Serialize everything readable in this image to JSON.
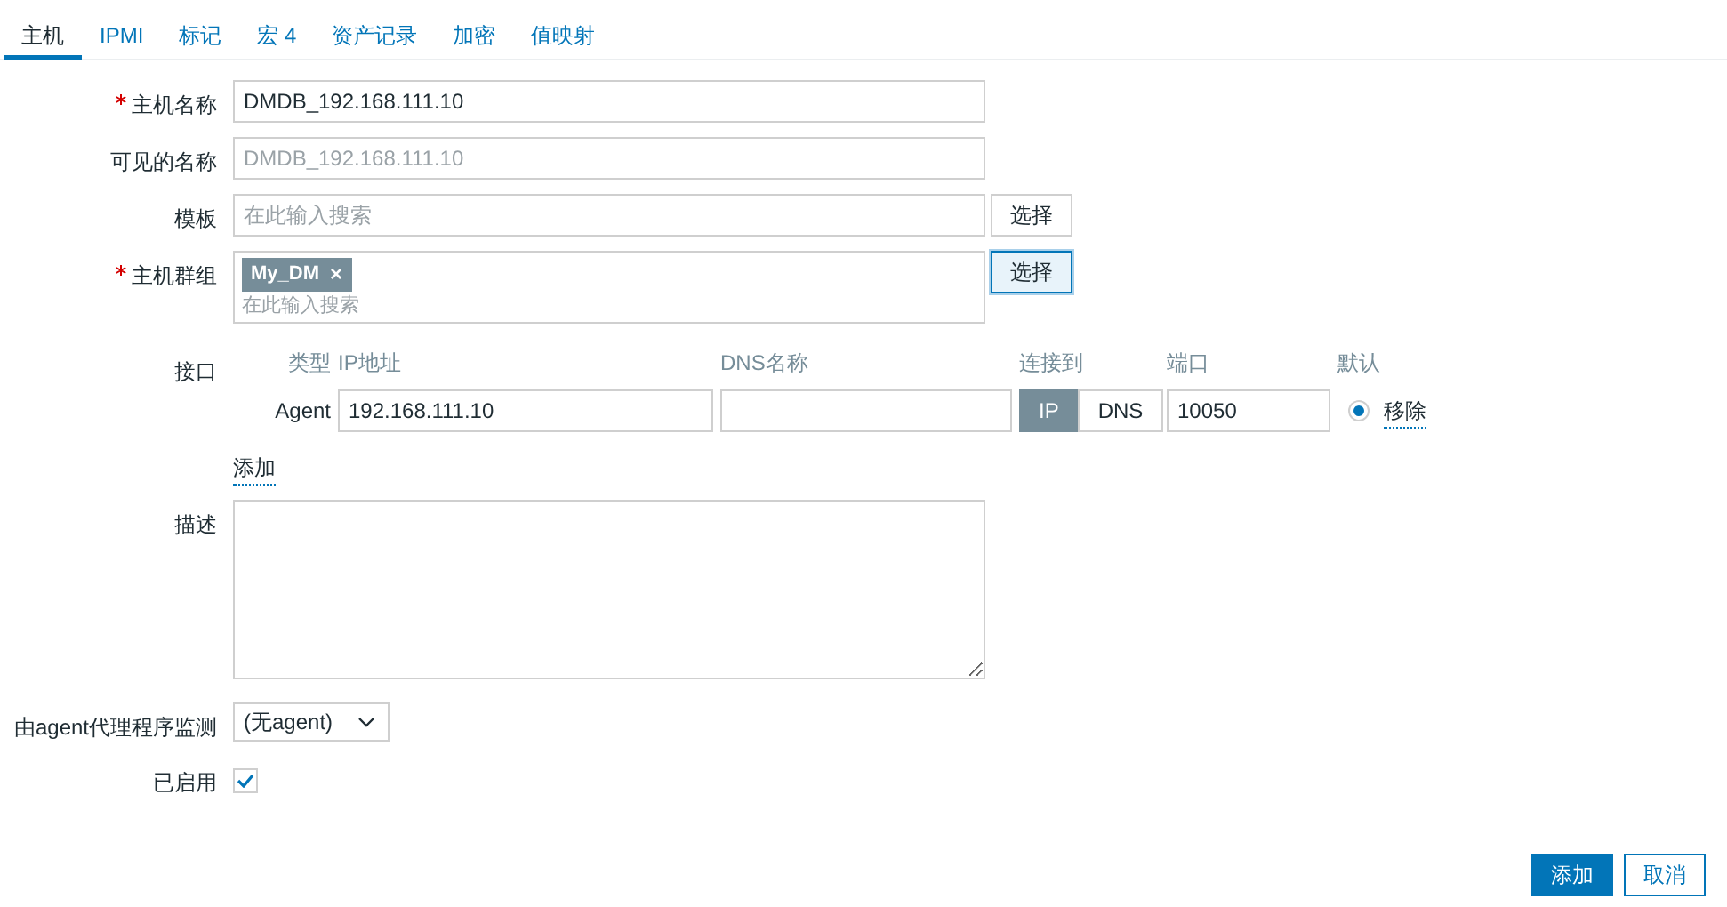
{
  "tabs": [
    {
      "label": "主机",
      "selected": true
    },
    {
      "label": "IPMI",
      "selected": false
    },
    {
      "label": "标记",
      "selected": false
    },
    {
      "label": "宏 4",
      "selected": false
    },
    {
      "label": "资产记录",
      "selected": false
    },
    {
      "label": "加密",
      "selected": false
    },
    {
      "label": "值映射",
      "selected": false
    }
  ],
  "host_name": {
    "label": "主机名称",
    "required": true,
    "value": "DMDB_192.168.111.10"
  },
  "visible_name": {
    "label": "可见的名称",
    "required": false,
    "placeholder": "DMDB_192.168.111.10"
  },
  "templates": {
    "label": "模板",
    "required": false,
    "placeholder": "在此输入搜索",
    "button": "选择",
    "focused": false
  },
  "host_groups": {
    "label": "主机群组",
    "required": true,
    "tags": [
      {
        "label": "My_DM",
        "remove": "×"
      }
    ],
    "placeholder": "在此输入搜索",
    "button": "选择",
    "focused": true
  },
  "interfaces": {
    "label": "接口",
    "headers": [
      "类型",
      "IP地址",
      "DNS名称",
      "连接到",
      "端口",
      "默认"
    ],
    "rows": [
      {
        "type": "Agent",
        "ip": "192.168.111.10",
        "dns": "",
        "connect": [
          {
            "label": "IP",
            "selected": true
          },
          {
            "label": "DNS",
            "selected": false
          }
        ],
        "port": "10050",
        "default": true,
        "remove": "移除"
      }
    ],
    "add_link": "添加"
  },
  "description": {
    "label": "描述"
  },
  "monitored_by": {
    "label": "由agent代理程序监测",
    "value": "(无agent)"
  },
  "enabled": {
    "label": "已启用",
    "checked": true
  },
  "buttons": [
    {
      "label": "添加",
      "kind": "primary"
    },
    {
      "label": "取消",
      "kind": "secondary"
    }
  ]
}
